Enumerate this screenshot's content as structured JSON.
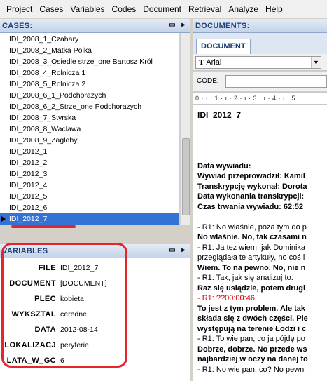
{
  "menu": [
    {
      "u": "P",
      "rest": "roject"
    },
    {
      "u": "C",
      "rest": "ases"
    },
    {
      "u": "V",
      "rest": "ariables"
    },
    {
      "u": "C",
      "rest": "odes"
    },
    {
      "u": "D",
      "rest": "ocument"
    },
    {
      "u": "R",
      "rest": "etrieval"
    },
    {
      "u": "A",
      "rest": "nalyze"
    },
    {
      "u": "H",
      "rest": "elp"
    }
  ],
  "cases": {
    "title": "CASES:",
    "items": [
      "IDI_2008_1_Czahary",
      "IDI_2008_2_Matka Polka",
      "IDI_2008_3_Osiedle strze_one Bartosz Król",
      "IDI_2008_4_Rolnicza 1",
      "IDI_2008_5_Rolnicza 2",
      "IDI_2008_6_1_Podchorazych",
      "IDI_2008_6_2_Strze_one Podchorazych",
      "IDI_2008_7_Styrska",
      "IDI_2008_8_Waclawa",
      "IDI_2008_9_Zagloby",
      "IDI_2012_1",
      "IDI_2012_2",
      "IDI_2012_3",
      "IDI_2012_4",
      "IDI_2012_5",
      "IDI_2012_6",
      "IDI_2012_7"
    ],
    "selected_index": 16
  },
  "variables": {
    "title": "VARIABLES",
    "rows": [
      {
        "key": "FILE",
        "value": "IDI_2012_7"
      },
      {
        "key": "DOCUMENT",
        "value": "[DOCUMENT]"
      },
      {
        "key": "PLEC",
        "value": "kobieta"
      },
      {
        "key": "WYKSZTAL",
        "value": "ceredne"
      },
      {
        "key": "DATA",
        "value": "2012-08-14"
      },
      {
        "key": "LOKALIZACJ",
        "value": "peryferie"
      },
      {
        "key": "LATA_W_GC",
        "value": "6"
      }
    ]
  },
  "documents": {
    "title": "DOCUMENTS:",
    "tab": "DOCUMENT",
    "font": "Arial",
    "code_label": "CODE:",
    "code_value": "",
    "ruler": "0 · ı · 1 · ı · 2 · ı · 3 · ı · 4 · ı · 5",
    "lines": [
      {
        "text": "IDI_2012_7",
        "style": "title"
      },
      {
        "text": "",
        "style": ""
      },
      {
        "text": "",
        "style": ""
      },
      {
        "text": "",
        "style": ""
      },
      {
        "text": "",
        "style": ""
      },
      {
        "text": "Data wywiadu:",
        "style": "b"
      },
      {
        "text": "Wywiad przeprowadził: Kamil",
        "style": "b"
      },
      {
        "text": "Transkrypcję wykonał: Dorota",
        "style": "b"
      },
      {
        "text": "Data wykonania transkrypcji:",
        "style": "b"
      },
      {
        "text": "Czas trwania wywiadu: 62:52",
        "style": "b"
      },
      {
        "text": "",
        "style": ""
      },
      {
        "text": "- R1: No właśnie, poza tym do p",
        "style": ""
      },
      {
        "text": "No właśnie. No, tak czasami n",
        "style": "b"
      },
      {
        "text": "- R1: Ja też wiem, jak Dominika",
        "style": ""
      },
      {
        "text": "przeglądała te artykuły, no coś i",
        "style": ""
      },
      {
        "text": "Wiem. To na pewno. No, nie n",
        "style": "b"
      },
      {
        "text": "- R1: Tak, jak się analizuj to.",
        "style": ""
      },
      {
        "text": "Raz się usiądzie, potem drugi",
        "style": "b"
      },
      {
        "text": "- R1: ??00:00:46",
        "style": "red"
      },
      {
        "text": "To jest z tym problem. Ale tak",
        "style": "b"
      },
      {
        "text": "składa się z dwóch części. Pie",
        "style": "b"
      },
      {
        "text": "występują na terenie Łodzi i c",
        "style": "b"
      },
      {
        "text": "- R1: To wie pan, co ja pójdę po",
        "style": ""
      },
      {
        "text": "Dobrze, dobrze. No przede ws",
        "style": "b"
      },
      {
        "text": "najbardziej w oczy na danej fo",
        "style": "b"
      },
      {
        "text": "- R1: No wie pan, co? No pewni",
        "style": ""
      }
    ]
  }
}
